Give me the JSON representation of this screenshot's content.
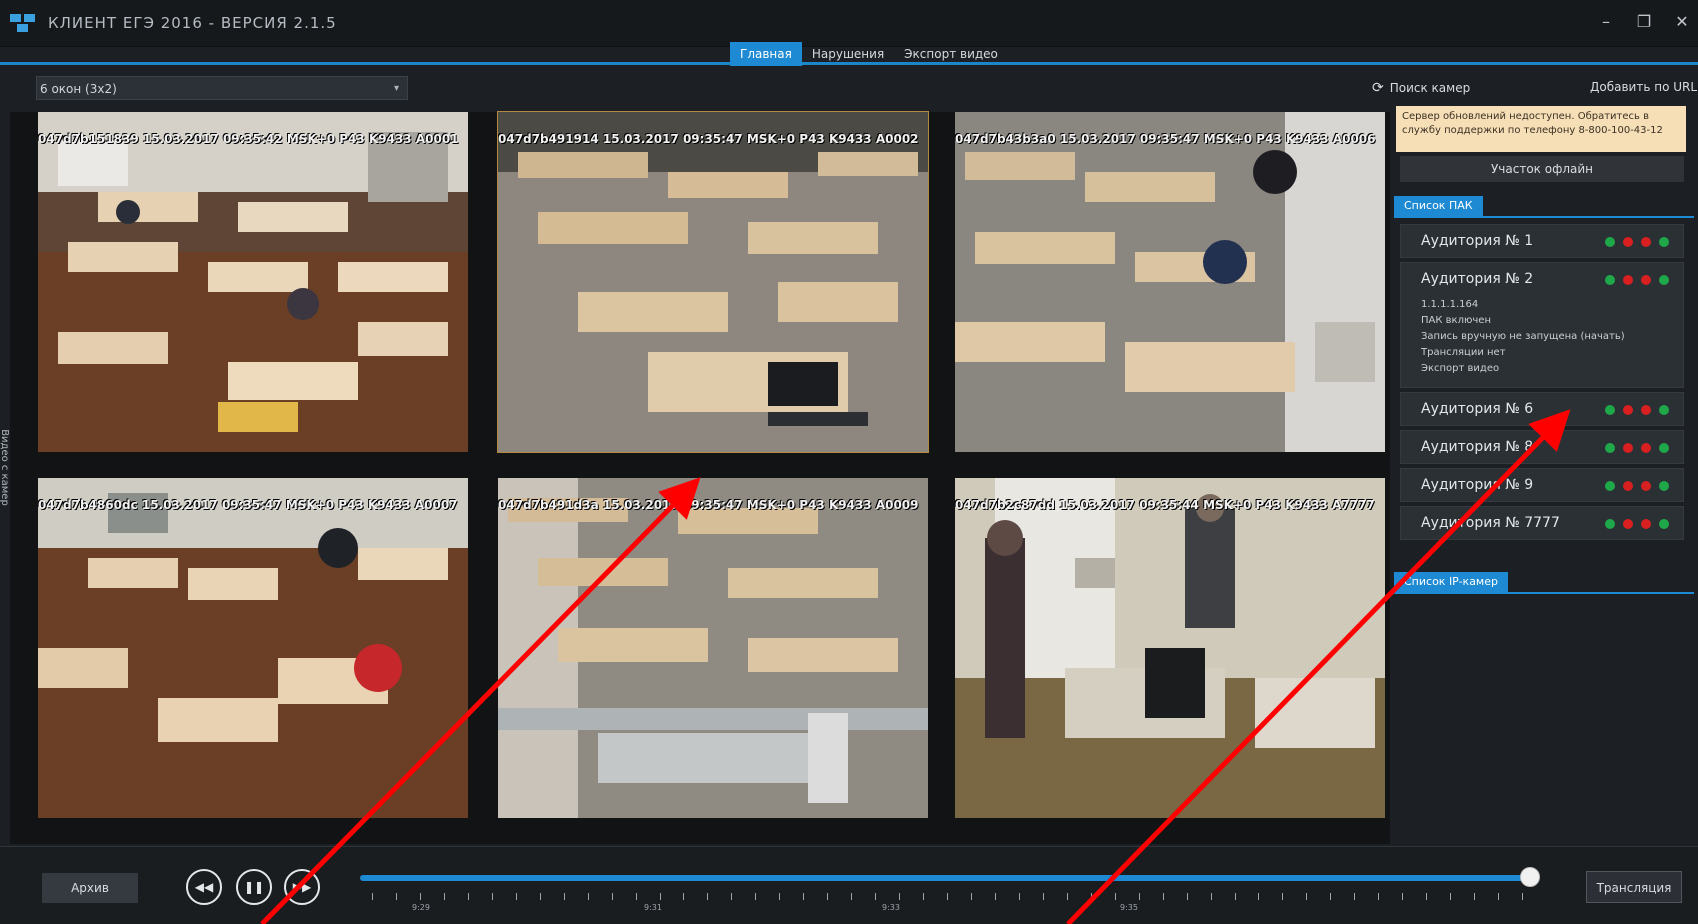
{
  "window": {
    "title": "КЛИЕНТ ЕГЭ 2016 - ВЕРСИЯ 2.1.5",
    "controls": [
      "–",
      "❐",
      "✕"
    ]
  },
  "tabs": [
    "Главная",
    "Нарушения",
    "Экспорт видео"
  ],
  "toolbar": {
    "layout_selected": "6 окон (3x2)",
    "search_cameras": "Поиск камер",
    "add_by_url": "Добавить по URL"
  },
  "side_label": "Видео с камер",
  "cameras": [
    {
      "osd": "047d7b151839 15.03.2017 09:35:42 MSK+0 P43 K9433 A0001",
      "selected": false
    },
    {
      "osd": "047d7b491914 15.03.2017 09:35:47 MSK+0 P43 K9433 A0002",
      "selected": true
    },
    {
      "osd": "047d7b43b3a0 15.03.2017 09:35:47 MSK+0 P43 K9433 A0006",
      "selected": false
    },
    {
      "osd": "047d7b4860dc 15.03.2017 09:35:47 MSK+0 P43 K9433 A0007",
      "selected": false
    },
    {
      "osd": "047d7b491d3a 15.03.2017 09:35:47 MSK+0 P43 K9433 A0009",
      "selected": false
    },
    {
      "osd": "047d7b2c87dd 15.03.2017 09:35:44 MSK+0 P43 K9433 A7777",
      "selected": false
    }
  ],
  "right_panel": {
    "notice_line1": "Сервер обновлений недоступен. Обратитесь в",
    "notice_line2": "службу поддержки по телефону 8-800-100-43-12",
    "offline_button": "Участок офлайн",
    "pak_tab": "Список ПАК",
    "rooms": [
      {
        "name": "Аудитория № 1"
      },
      {
        "name": "Аудитория № 2",
        "details": [
          "1.1.1.1.164",
          "ПАК включен",
          "Запись вручную не запущена (начать)",
          "Трансляции нет",
          "Экспорт видео"
        ]
      },
      {
        "name": "Аудитория № 6"
      },
      {
        "name": "Аудитория № 8"
      },
      {
        "name": "Аудитория № 9"
      },
      {
        "name": "Аудитория № 7777"
      }
    ],
    "ip_cameras_tab": "Список IP-камер"
  },
  "bottom": {
    "archive_button": "Архив",
    "playback": [
      "rewind-icon",
      "pause-icon",
      "forward-icon"
    ],
    "time_labels": [
      "9:29",
      "9:31",
      "9:33",
      "9:35"
    ],
    "broadcast_button": "Трансляция"
  },
  "colors": {
    "accent": "#1d8ad3",
    "status_green": "#1fa84a",
    "status_red": "#d82020",
    "annotation_red": "#ff0000",
    "notice_bg": "#f6dfb7"
  }
}
